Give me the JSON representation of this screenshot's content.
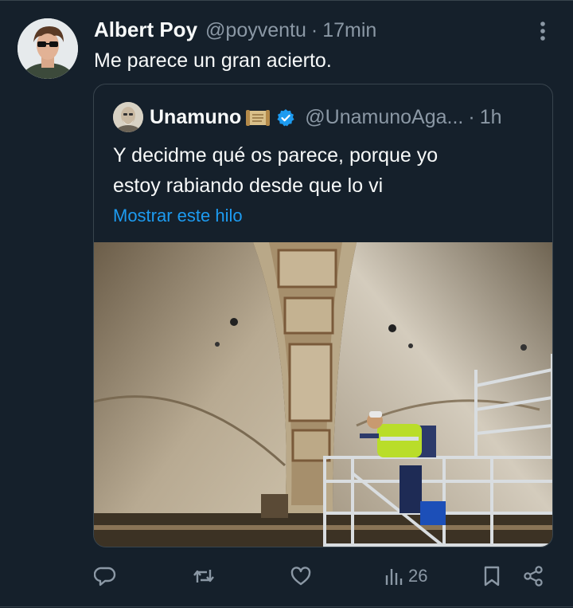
{
  "tweet": {
    "author_name": "Albert Poy",
    "author_handle": "@poyventu",
    "separator": "·",
    "time": "17min",
    "text": "Me parece un gran acierto.",
    "more_icon": "more-vertical-icon"
  },
  "quoted": {
    "author_name": "Unamuno",
    "author_handle": "@UnamunoAga...",
    "separator": "·",
    "time": "1h",
    "text_lines": [
      "Y decidme qué os parece, porque yo",
      "estoy rabiando desde que lo vi"
    ],
    "show_thread": "Mostrar este hilo",
    "badges": [
      "scroll-icon",
      "verified-icon"
    ],
    "media": "photo of a worker on scaffolding restoring a vaulted painted ceiling"
  },
  "actions": {
    "reply_icon": "reply-icon",
    "retweet_icon": "retweet-icon",
    "like_icon": "like-icon",
    "views_icon": "views-icon",
    "views_count": "26",
    "bookmark_icon": "bookmark-icon",
    "share_icon": "share-icon"
  },
  "colors": {
    "background": "#15202b",
    "text": "#f7f9f9",
    "secondary": "#8b98a5",
    "link": "#1d9bf0",
    "border": "#38444d"
  }
}
